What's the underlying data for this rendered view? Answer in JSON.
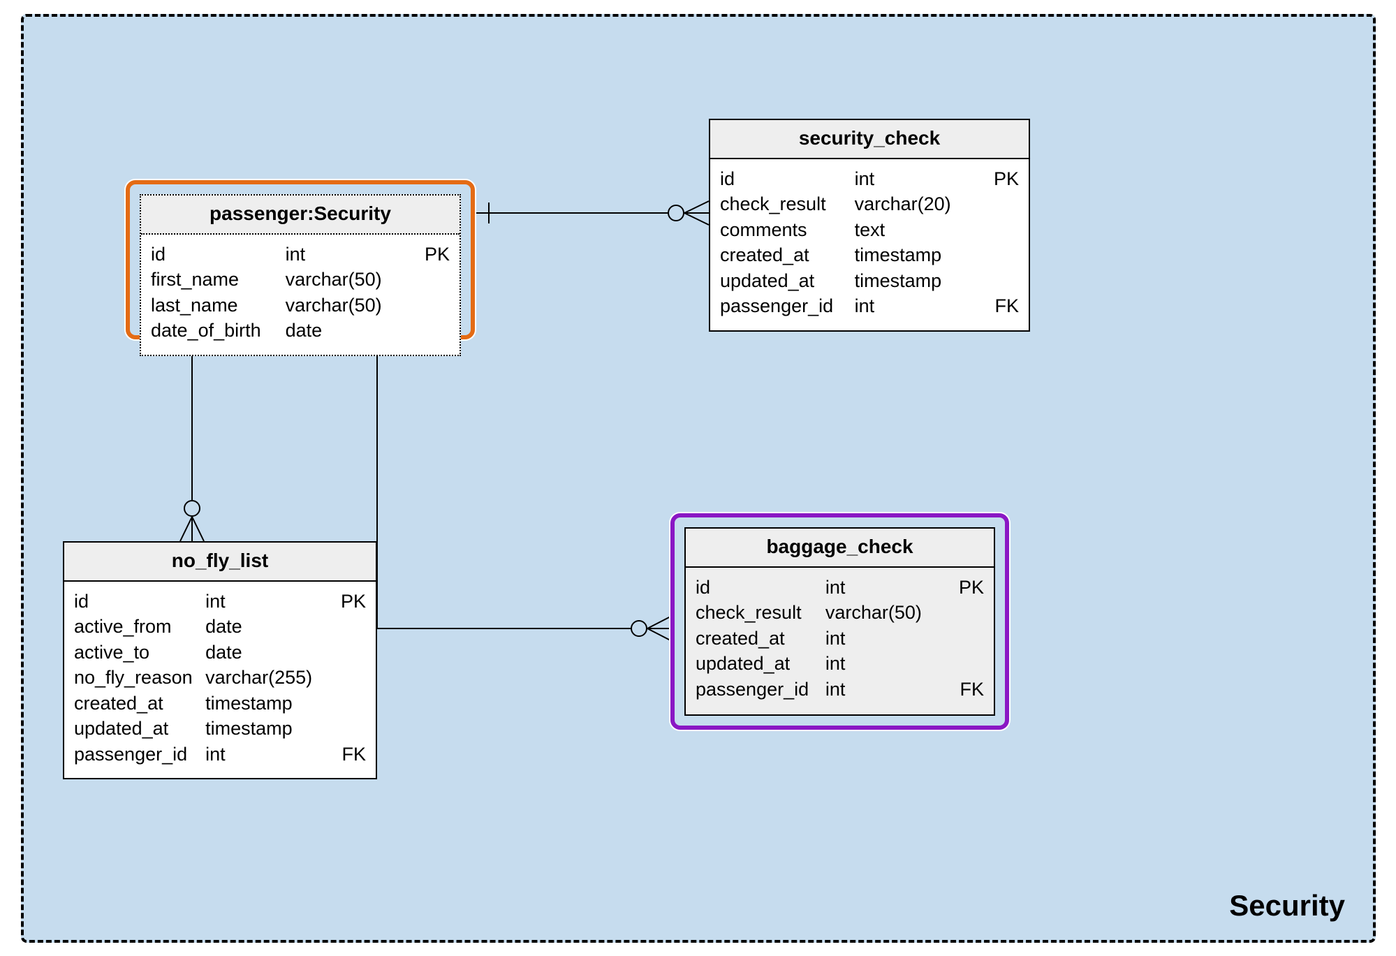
{
  "container": {
    "label": "Security"
  },
  "entities": {
    "passenger": {
      "title": "passenger:Security",
      "cols": [
        {
          "name": "id",
          "type": "int",
          "key": "PK"
        },
        {
          "name": "first_name",
          "type": "varchar(50)",
          "key": ""
        },
        {
          "name": "last_name",
          "type": "varchar(50)",
          "key": ""
        },
        {
          "name": "date_of_birth",
          "type": "date",
          "key": ""
        }
      ]
    },
    "security_check": {
      "title": "security_check",
      "cols": [
        {
          "name": "id",
          "type": "int",
          "key": "PK"
        },
        {
          "name": "check_result",
          "type": "varchar(20)",
          "key": ""
        },
        {
          "name": "comments",
          "type": "text",
          "key": ""
        },
        {
          "name": "created_at",
          "type": "timestamp",
          "key": ""
        },
        {
          "name": "updated_at",
          "type": "timestamp",
          "key": ""
        },
        {
          "name": "passenger_id",
          "type": "int",
          "key": "FK"
        }
      ]
    },
    "no_fly_list": {
      "title": "no_fly_list",
      "cols": [
        {
          "name": "id",
          "type": "int",
          "key": "PK"
        },
        {
          "name": "active_from",
          "type": "date",
          "key": ""
        },
        {
          "name": "active_to",
          "type": "date",
          "key": ""
        },
        {
          "name": "no_fly_reason",
          "type": "varchar(255)",
          "key": ""
        },
        {
          "name": "created_at",
          "type": "timestamp",
          "key": ""
        },
        {
          "name": "updated_at",
          "type": "timestamp",
          "key": ""
        },
        {
          "name": "passenger_id",
          "type": "int",
          "key": "FK"
        }
      ]
    },
    "baggage_check": {
      "title": "baggage_check",
      "cols": [
        {
          "name": "id",
          "type": "int",
          "key": "PK"
        },
        {
          "name": "check_result",
          "type": "varchar(50)",
          "key": ""
        },
        {
          "name": "created_at",
          "type": "int",
          "key": ""
        },
        {
          "name": "updated_at",
          "type": "int",
          "key": ""
        },
        {
          "name": "passenger_id",
          "type": "int",
          "key": "FK"
        }
      ]
    }
  },
  "relationships": [
    {
      "from": "passenger",
      "to": "security_check",
      "type": "one-to-zero-or-many"
    },
    {
      "from": "passenger",
      "to": "no_fly_list",
      "type": "one-to-zero-or-many"
    },
    {
      "from": "passenger",
      "to": "baggage_check",
      "type": "one-to-zero-or-many"
    }
  ]
}
